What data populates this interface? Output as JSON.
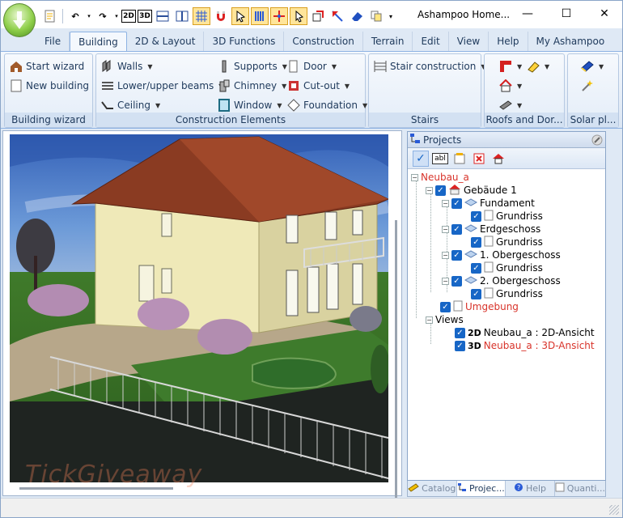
{
  "window": {
    "title": "Ashampoo Home...",
    "controls": {
      "minimize": "—",
      "maximize": "☐",
      "close": "✕"
    }
  },
  "quick_access": [
    {
      "icon": "new-file-icon",
      "text": ""
    },
    {
      "icon": "undo-icon",
      "text": "↶"
    },
    {
      "icon": "redo-icon",
      "text": "↷"
    },
    {
      "icon": "view-2d-icon",
      "text": "2D"
    },
    {
      "icon": "view-3d-icon",
      "text": "3D"
    },
    {
      "icon": "split-horizontal-icon",
      "text": ""
    },
    {
      "icon": "split-vertical-icon",
      "text": ""
    },
    {
      "icon": "grid-icon",
      "text": ""
    },
    {
      "icon": "snap-magnet-icon",
      "text": ""
    },
    {
      "icon": "cursor-select-icon",
      "text": ""
    },
    {
      "icon": "column-bars-icon",
      "text": ""
    },
    {
      "icon": "axis-move-icon",
      "text": ""
    },
    {
      "icon": "pointer-icon",
      "text": ""
    },
    {
      "icon": "rotate-object-icon",
      "text": ""
    },
    {
      "icon": "measure-icon",
      "text": ""
    },
    {
      "icon": "eraser-icon",
      "text": ""
    },
    {
      "icon": "copy-icon",
      "text": ""
    }
  ],
  "tabs": [
    "File",
    "Building",
    "2D & Layout",
    "3D Functions",
    "Construction",
    "Terrain",
    "Edit",
    "View",
    "Help",
    "My Ashampoo"
  ],
  "active_tab": "Building",
  "ribbon": {
    "building_wizard": {
      "caption": "Building wizard",
      "start_wizard": "Start wizard",
      "new_building": "New building"
    },
    "construction_elements": {
      "caption": "Construction Elements",
      "walls": "Walls",
      "beams": "Lower/upper beams",
      "ceiling": "Ceiling",
      "supports": "Supports",
      "chimney": "Chimney",
      "window": "Window",
      "door": "Door",
      "cutout": "Cut-out",
      "foundation": "Foundation"
    },
    "stairs": {
      "caption": "Stairs",
      "stair_construction": "Stair construction"
    },
    "roofs": {
      "caption": "Roofs and Dor..."
    },
    "solar": {
      "caption": "Solar pl..."
    }
  },
  "projects_panel": {
    "title": "Projects",
    "toolbar": [
      {
        "icon": "check-icon",
        "text": "✓"
      },
      {
        "icon": "label-abl-icon",
        "text": "abl"
      },
      {
        "icon": "properties-icon",
        "text": ""
      },
      {
        "icon": "delete-icon",
        "text": ""
      },
      {
        "icon": "add-building-icon",
        "text": ""
      }
    ],
    "tree": {
      "project": "Neubau_a",
      "building": "Gebäude 1",
      "floors": [
        {
          "name": "Fundament",
          "plan": "Grundriss"
        },
        {
          "name": "Erdgeschoss",
          "plan": "Grundriss"
        },
        {
          "name": "1. Obergeschoss",
          "plan": "Grundriss"
        },
        {
          "name": "2. Obergeschoss",
          "plan": "Grundriss"
        }
      ],
      "surroundings": "Umgebung",
      "views_label": "Views",
      "views": [
        {
          "badge": "2D",
          "label": "Neubau_a : 2D-Ansicht"
        },
        {
          "badge": "3D",
          "label": "Neubau_a : 3D-Ansicht"
        }
      ]
    }
  },
  "bottom_tabs": [
    "Catalog",
    "Projec...",
    "Help",
    "Quanti..."
  ],
  "active_bottom_tab": "Projec...",
  "watermark": "TickGiveaway",
  "colors": {
    "accent": "#1766c6",
    "highlight_red": "#d8332a",
    "ribbon_bg": "#dfe9f5",
    "sky": "#3d74c8",
    "roof": "#8a3b22",
    "wall": "#efe9b8"
  }
}
